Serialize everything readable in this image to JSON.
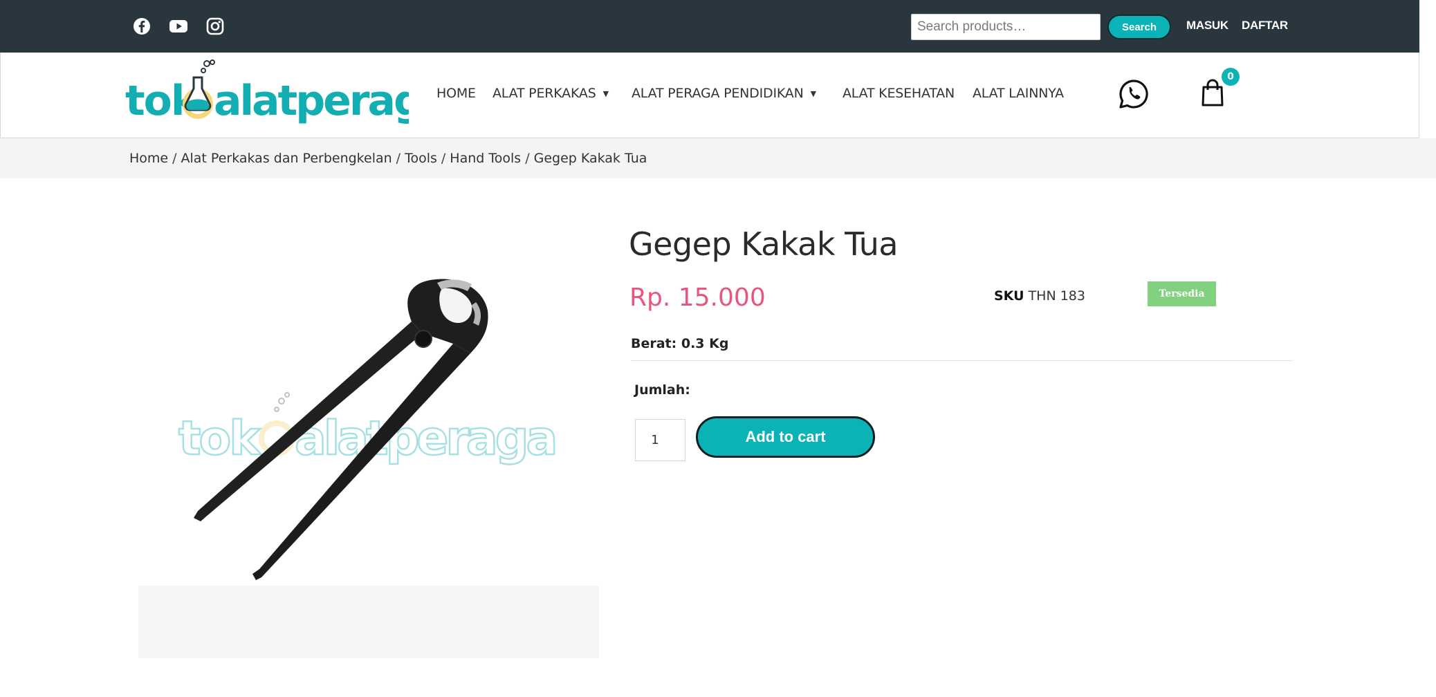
{
  "topbar": {
    "social": [
      {
        "icon": "facebook-icon"
      },
      {
        "icon": "youtube-icon"
      },
      {
        "icon": "instagram-icon"
      }
    ],
    "search": {
      "placeholder": "Search products…",
      "value": ""
    },
    "search_button": "Search",
    "login": "MASUK",
    "register": "DAFTAR"
  },
  "header": {
    "logo_text": "tok alatperaga",
    "nav": [
      {
        "label": "HOME",
        "has_dropdown": false
      },
      {
        "label": "ALAT PERKAKAS",
        "has_dropdown": true
      },
      {
        "label": "ALAT PERAGA PENDIDIKAN",
        "has_dropdown": true
      },
      {
        "label": "ALAT KESEHATAN",
        "has_dropdown": false
      },
      {
        "label": "ALAT LAINNYA",
        "has_dropdown": false
      }
    ],
    "whatsapp_icon": "whatsapp-icon",
    "cart_icon": "shopping-bag-icon",
    "cart_count": "0"
  },
  "breadcrumb": [
    "Home",
    "Alat Perkakas dan Perbengkelan",
    "Tools",
    "Hand Tools",
    "Gegep Kakak Tua"
  ],
  "product": {
    "image_watermark": "tok alatperaga",
    "title": "Gegep Kakak Tua",
    "price": "Rp. 15.000",
    "sku_label": "SKU",
    "sku_value": "THN 183",
    "stock": "Tersedia",
    "weight": "Berat: 0.3 Kg",
    "quantity_label": "Jumlah:",
    "quantity": "1",
    "add_to_cart": "Add to cart"
  },
  "colors": {
    "topbar_bg": "#2a363d",
    "accent": "#0bb3b7",
    "price": "#e7577d",
    "stock_badge": "#81d17e",
    "breadcrumb_bg": "#f4f4f4"
  }
}
